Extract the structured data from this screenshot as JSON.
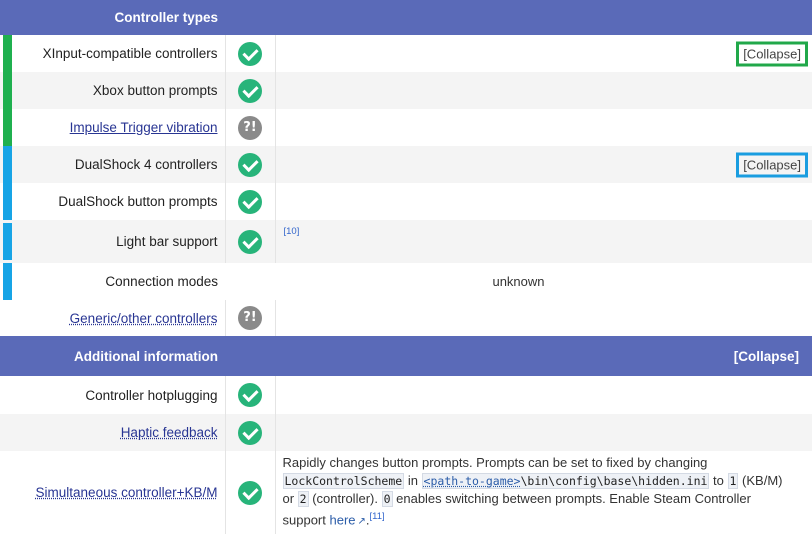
{
  "section_controller": {
    "title": "Controller types"
  },
  "rows_controller": [
    {
      "label": "XInput-compatible controllers",
      "status": "check",
      "extra": "",
      "collapse": "[Collapse]"
    },
    {
      "label": "Xbox button prompts",
      "status": "check",
      "extra": ""
    },
    {
      "label": "Impulse Trigger vibration",
      "status": "unknown",
      "extra": ""
    },
    {
      "label": "DualShock 4 controllers",
      "status": "check",
      "extra": "",
      "collapse": "[Collapse]"
    },
    {
      "label": "DualShock button prompts",
      "status": "check",
      "extra": ""
    },
    {
      "label": "Light bar support",
      "status": "check",
      "ref": "[10]"
    },
    {
      "label": "Connection modes",
      "value": "unknown"
    },
    {
      "label": "Generic/other controllers",
      "status": "unknown"
    }
  ],
  "section_additional": {
    "title": "Additional information",
    "collapse": "[Collapse]"
  },
  "rows_additional": [
    {
      "label": "Controller hotplugging",
      "status": "check"
    },
    {
      "label": "Haptic feedback",
      "status": "check"
    },
    {
      "label": "Simultaneous controller+KB/M",
      "status": "check"
    }
  ],
  "simultaneous_note": {
    "t1": "Rapidly changes button prompts. Prompts can be set to fixed by changing",
    "code1": "LockControlScheme",
    "t2": " in ",
    "code2": "<path-to-game>",
    "code3": "\\bin\\config\\base\\hidden.ini",
    "t3": " to ",
    "code4": "1",
    "t4": " (KB/M)",
    "t5": "or ",
    "code5": "2",
    "t6": " (controller). ",
    "code6": "0",
    "t7": " enables switching between prompts. Enable Steam Controller",
    "t8": "support ",
    "here": "here",
    "t9": ".",
    "ref": "[11]"
  },
  "icons": {
    "check": "check-circle-icon",
    "unknown": "unknown-question-icon",
    "external": "external-link-icon"
  },
  "colors": {
    "header_bg": "#5a6ab8",
    "xinput_group_bar": "#1fb04f",
    "dualshock_group_bar": "#17a4e6",
    "check_green": "#27b47a",
    "unknown_gray": "#8a8a8a"
  }
}
